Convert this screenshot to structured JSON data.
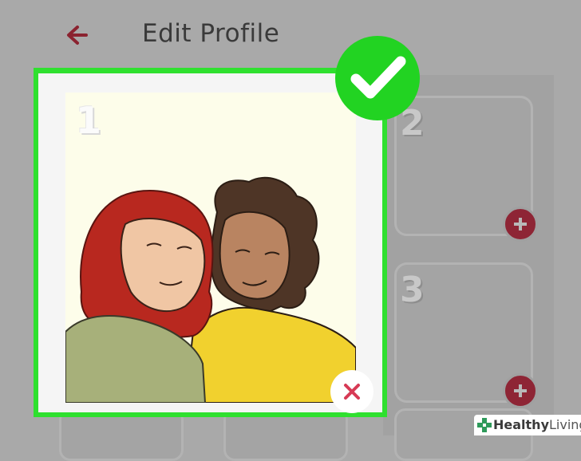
{
  "header": {
    "back_icon": "arrow-left-icon",
    "title": "Edit Profile",
    "accent_color": "#8b2330"
  },
  "photo_slots": [
    {
      "number": "1",
      "state": "filled",
      "action_icon": "close-icon"
    },
    {
      "number": "2",
      "state": "empty",
      "action_icon": "plus-icon"
    },
    {
      "number": "3",
      "state": "empty",
      "action_icon": "plus-icon"
    }
  ],
  "selection": {
    "icon": "checkmark-icon",
    "color": "#22d322"
  },
  "watermark": {
    "brand_bold": "Healthy",
    "brand_light": "Living",
    "icon": "cross-icon"
  }
}
